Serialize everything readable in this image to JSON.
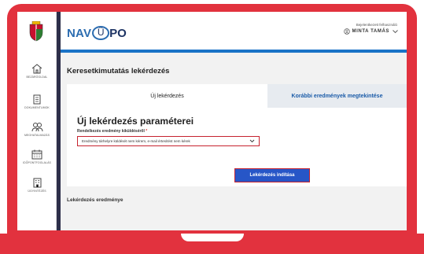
{
  "sidebar": {
    "items": [
      {
        "label": "BEZÁRÓOLDAL",
        "icon": "home-icon"
      },
      {
        "label": "DOKUMENTUMOK",
        "icon": "document-icon"
      },
      {
        "label": "MEGHATALMAZÁS",
        "icon": "people-icon"
      },
      {
        "label": "IDŐPONTFOGLALÁS",
        "icon": "calendar-icon"
      },
      {
        "label": "ÜGYINTÉZÉS",
        "icon": "building-icon"
      }
    ]
  },
  "header": {
    "logo_nav": "NAV",
    "logo_onyf": "ÜPO",
    "user_label": "Bejelentkezett felhasználó",
    "user_name": "MINTA TAMÁS"
  },
  "page": {
    "title": "Keresetkimutatás lekérdezés"
  },
  "tabs": [
    {
      "label": "Új lekérdezés",
      "active": true
    },
    {
      "label": "Korábbi eredmények megtekintése",
      "active": false
    }
  ],
  "form": {
    "title": "Új lekérdezés paraméterei",
    "field_label": "Rendelkezés eredmény kiküldéséről",
    "required_mark": "*",
    "select_value": "Eredmény tárhelyre küldését nem kérem, e-mail értesítést nem kérek",
    "submit_label": "Lekérdezés indítása"
  },
  "result": {
    "title": "Lekérdezés eredménye"
  },
  "colors": {
    "frame": "#e2323e",
    "primary": "#2756c7",
    "highlight": "#c6232f"
  }
}
